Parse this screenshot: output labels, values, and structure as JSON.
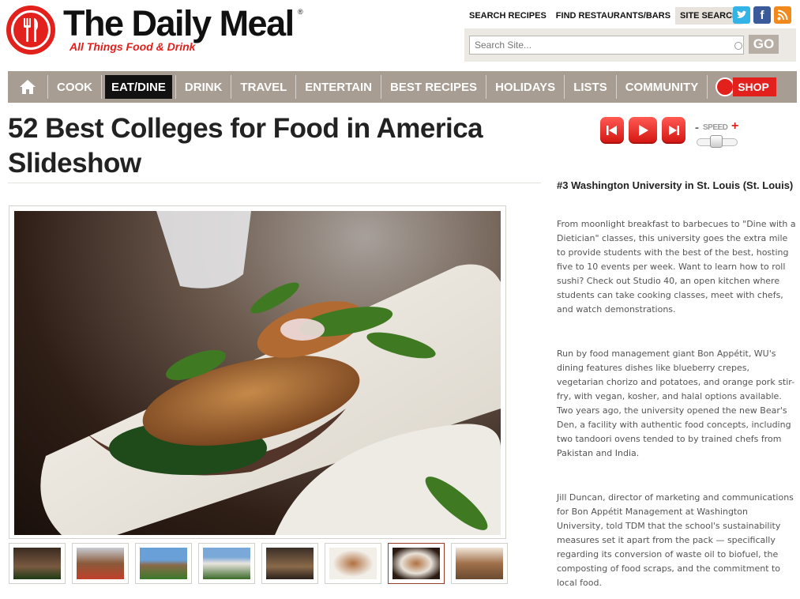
{
  "header": {
    "site_name": "The Daily Meal",
    "registered_mark": "®",
    "tagline": "All Things Food & Drink",
    "top_links": [
      "SEARCH RECIPES",
      "FIND RESTAURANTS/BARS",
      "SITE SEARCH"
    ],
    "active_top_link": "SITE SEARCH",
    "social_icons": [
      "twitter-icon",
      "facebook-icon",
      "rss-icon"
    ],
    "search": {
      "placeholder": "Search Site...",
      "go_label": "GO"
    }
  },
  "nav": {
    "items": [
      "COOK",
      "EAT/DINE",
      "DRINK",
      "TRAVEL",
      "ENTERTAIN",
      "BEST RECIPES",
      "HOLIDAYS",
      "LISTS",
      "COMMUNITY"
    ],
    "active": "EAT/DINE",
    "shop_label": "SHOP"
  },
  "main": {
    "title": "52 Best Colleges for Food in America Slideshow",
    "thumbnails_count": 8,
    "active_thumbnail": 7
  },
  "player": {
    "controls": [
      "previous-icon",
      "play-icon",
      "next-icon"
    ],
    "speed_label": "SPEED",
    "speed_minus": "-",
    "speed_plus": "+"
  },
  "slide": {
    "heading": "#3 Washington University in St. Louis (St. Louis)",
    "paragraphs": [
      "From moonlight breakfast to barbecues to \"Dine with a Dietician\" classes, this university goes the extra mile to provide students with the best of the best, hosting five to 10 events per week. Want to learn how to roll sushi? Check out Studio 40, an open kitchen where students can take cooking classes, meet with chefs, and watch demonstrations.",
      "Run by food management giant Bon Appétit, WU's dining features dishes like blueberry crepes, vegetarian chorizo and potatoes, and orange pork stir-fry, with vegan, kosher, and halal options available. Two years ago, the university opened the new Bear's Den, a facility with authentic food concepts, including two tandoori ovens tended to by trained chefs from Pakistan and India.",
      "Jill Duncan, director of marketing and communications for Bon Appétit Management at Washington University, told TDM that the school's sustainability measures set it apart from the pack — specifically regarding its conversion of waste oil to biofuel, the composting of food scraps, and the commitment to local food."
    ]
  },
  "colors": {
    "brand_red": "#e2201c",
    "nav_bg": "#a89d93",
    "nav_active_bg": "#111111"
  }
}
